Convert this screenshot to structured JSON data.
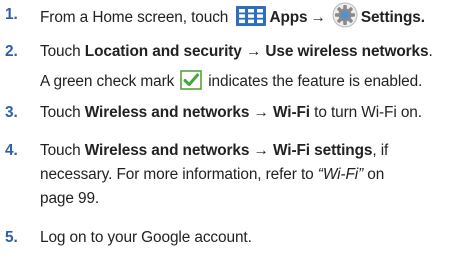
{
  "steps": [
    {
      "number": "1.",
      "parts": {
        "pre": "From a Home screen, touch",
        "apps": "Apps",
        "arrow": "→",
        "settings": "Settings."
      },
      "icons": [
        "apps-grid-icon",
        "settings-gear-icon"
      ]
    },
    {
      "number": "2.",
      "parts": {
        "pre": "Touch",
        "menu1": "Location and security",
        "arrow": "→",
        "menu2": "Use wireless networks",
        "post": "."
      },
      "note": {
        "pre": "A green check mark",
        "post": "indicates the feature is enabled."
      },
      "icons": [
        "green-check-icon"
      ]
    },
    {
      "number": "3.",
      "parts": {
        "pre": "Touch",
        "menu1": "Wireless and networks",
        "arrow": "→",
        "menu2": "Wi-Fi",
        "post": "to turn Wi-Fi on."
      }
    },
    {
      "number": "4.",
      "parts": {
        "pre": "Touch",
        "menu1": "Wireless and networks",
        "arrow": "→",
        "menu2": "Wi-Fi settings",
        "post": ", if"
      },
      "line2": {
        "pre": "necessary. For more information, refer to",
        "ref": "“Wi-Fi”",
        "post": "on"
      },
      "line3": "page 99."
    },
    {
      "number": "5.",
      "text": "Log on to your Google account."
    }
  ],
  "colors": {
    "step_number": "#2f5fa6",
    "apps_icon": "#2d6fbe",
    "check_border": "#54a33a",
    "check_mark": "#3ea83a"
  }
}
